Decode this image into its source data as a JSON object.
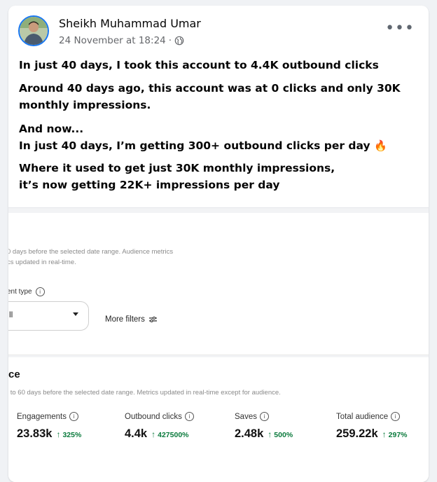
{
  "post": {
    "author": "Sheikh Muhammad Umar",
    "timestamp": "24 November at 18:24",
    "separator": "·",
    "more_label": "•••",
    "paragraphs": {
      "p1": "In just 40 days, I took this account to 4.4K outbound clicks",
      "p2": "Around 40 days ago, this account was at 0 clicks and only 30K monthly impressions.",
      "p3a": "And now...",
      "p3b": "In just 40 days, I’m getting 300+ outbound clicks per day",
      "p3_emoji": "🔥",
      "p4a": "Where it used to get just 30K monthly impressions,",
      "p4b": "it’s now getting 22K+ impressions per day"
    }
  },
  "screenshot": {
    "top_note_line1": "0 days before the selected date range. Audience metrics",
    "top_note_line2": "cs updated in real-time.",
    "content_type_label": "ent type",
    "content_type_value": "ll",
    "more_filters_label": "More filters",
    "section_title": "ce",
    "section_note": "l to 60 days before the selected date range. Metrics updated in real-time except for audience.",
    "info_glyph": "i",
    "arrow_glyph": "↑",
    "metrics": [
      {
        "label": "Engagements",
        "value": "23.83k",
        "change": "325%"
      },
      {
        "label": "Outbound clicks",
        "value": "4.4k",
        "change": "427500%"
      },
      {
        "label": "Saves",
        "value": "2.48k",
        "change": "500%"
      },
      {
        "label": "Total audience",
        "value": "259.22k",
        "change": "297%"
      }
    ]
  },
  "colors": {
    "brand_blue": "#1877f2",
    "positive_green": "#0a7a3c",
    "meta_grey": "#65676b"
  },
  "icons": [
    "avatar",
    "globe-icon",
    "more-options-icon",
    "info-icon",
    "chevron-down-icon",
    "filter-icon",
    "arrow-up-icon",
    "fire-emoji"
  ]
}
